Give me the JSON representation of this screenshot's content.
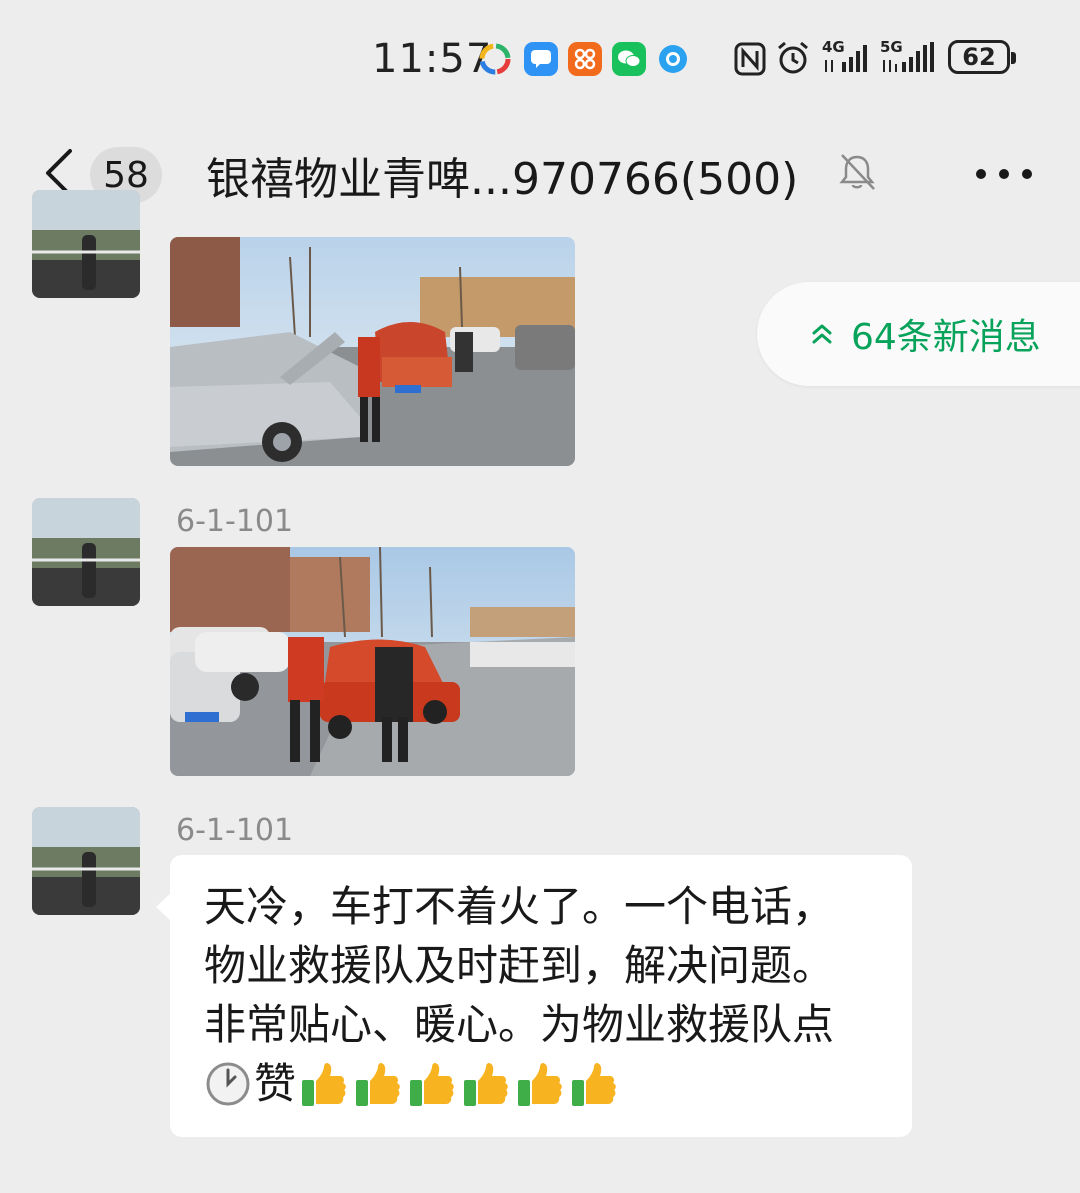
{
  "status_bar": {
    "time": "11:57",
    "signal_4g": "4G",
    "signal_5g": "5G",
    "battery": "62"
  },
  "header": {
    "unread_count": "58",
    "title": "银禧物业青啤...970766(500)"
  },
  "new_messages": {
    "label": "64条新消息"
  },
  "messages": [
    {
      "type": "image",
      "sender": ""
    },
    {
      "type": "image",
      "sender": "6-1-101"
    },
    {
      "type": "text",
      "sender": "6-1-101",
      "lines": [
        "天冷，车打不着火了。一个电话，",
        "物业救援队及时赶到，解决问题。",
        "非常贴心、暖心。为物业救援队点"
      ],
      "last_line": "赞"
    }
  ],
  "colors": {
    "background": "#ededed",
    "bubble": "#ffffff",
    "accent_green": "#07a35a"
  }
}
